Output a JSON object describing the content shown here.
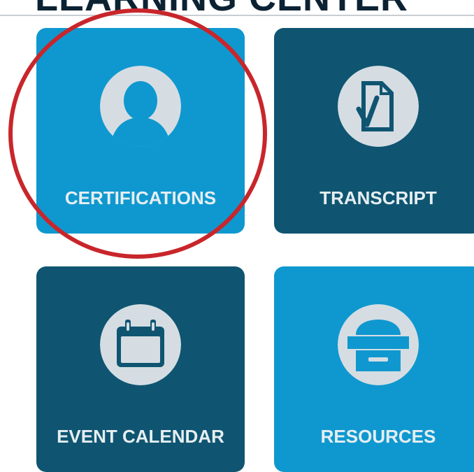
{
  "header": {
    "title": "LEARNING CENTER"
  },
  "tiles": [
    {
      "label": "CERTIFICATIONS",
      "icon": "user-icon",
      "color": "#0f98cf"
    },
    {
      "label": "TRANSCRIPT",
      "icon": "document-check-icon",
      "color": "#0f5571"
    },
    {
      "label": "EVENT CALENDAR",
      "icon": "calendar-icon",
      "color": "#0f5571"
    },
    {
      "label": "RESOURCES",
      "icon": "printer-icon",
      "color": "#0f98cf"
    }
  ],
  "highlight": {
    "target": "CERTIFICATIONS",
    "color": "#c8262b"
  }
}
